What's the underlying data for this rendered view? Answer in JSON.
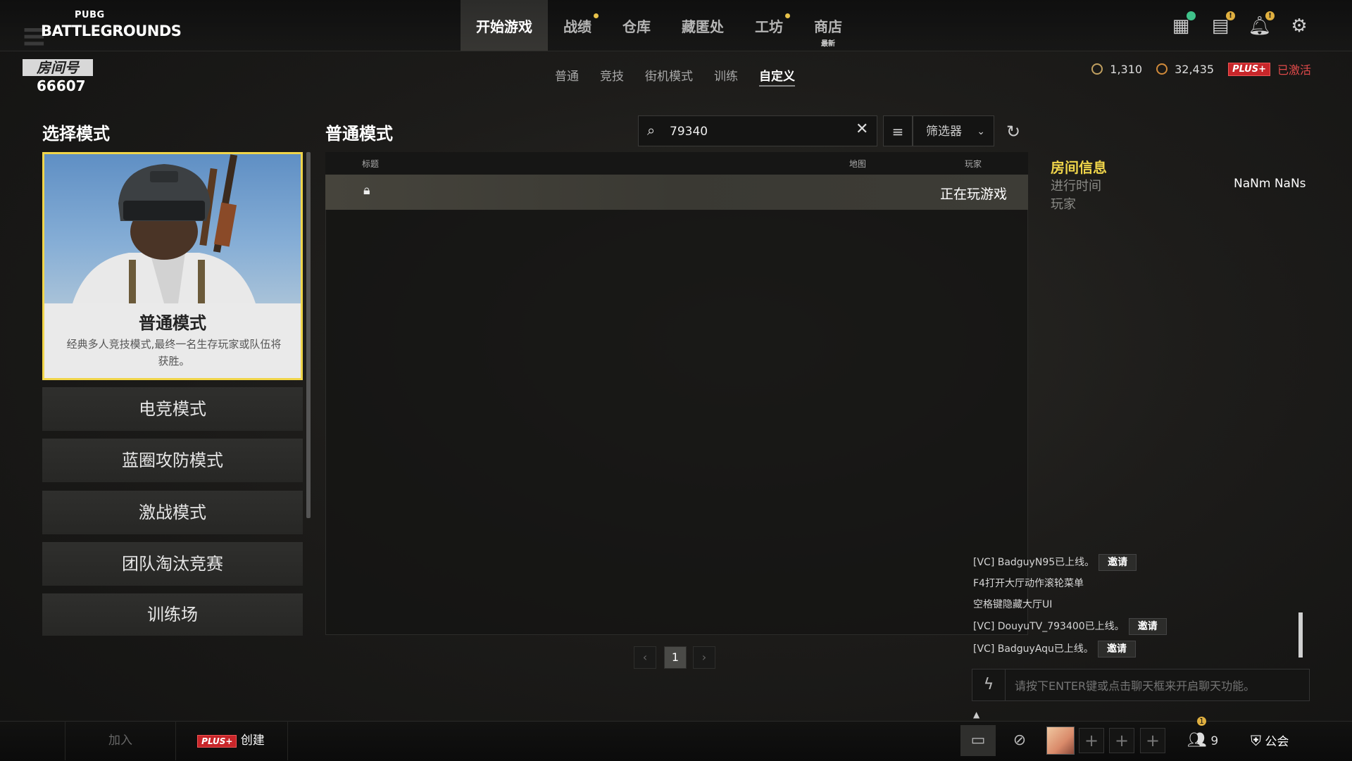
{
  "app": {
    "logo_small": "PUBG",
    "logo_main": "BATTLEGROUNDS",
    "room_label": "房间号",
    "room_number": "66607"
  },
  "nav": {
    "tabs": [
      {
        "label": "开始游戏"
      },
      {
        "label": "战绩"
      },
      {
        "label": "仓库"
      },
      {
        "label": "藏匿处"
      },
      {
        "label": "工坊"
      },
      {
        "label": "商店",
        "badge": "最新"
      }
    ],
    "sub_tabs": [
      "普通",
      "竞技",
      "街机模式",
      "训练",
      "自定义"
    ]
  },
  "currency": {
    "g_coin": "1,310",
    "bp": "32,435",
    "plus_badge": "PLUS+",
    "plus_status": "已激活"
  },
  "left": {
    "title": "选择模式",
    "selected_mode": {
      "name": "普通模式",
      "description": "经典多人竞技模式,最终一名生存玩家或队伍将获胜。"
    },
    "modes": [
      "电竞模式",
      "蓝圈攻防模式",
      "激战模式",
      "团队淘汰竞赛",
      "训练场"
    ]
  },
  "list": {
    "title": "普通模式",
    "search_value": "79340",
    "filter_label": "筛选器",
    "columns": {
      "title": "标题",
      "map": "地图",
      "players": "玩家"
    },
    "rows": [
      {
        "status": "正在玩游戏"
      }
    ],
    "page": "1"
  },
  "room_info": {
    "title": "房间信息",
    "elapsed_label": "进行时间",
    "elapsed_value": "NaNm NaNs",
    "players_label": "玩家"
  },
  "chat": {
    "lines": [
      {
        "text": "[VC] BadguyN95已上线。",
        "invite": "邀请"
      },
      {
        "text": "F4打开大厅动作滚轮菜单"
      },
      {
        "text": "空格键隐藏大厅UI"
      },
      {
        "text": "[VC] DouyuTV_793400已上线。",
        "invite": "邀请"
      },
      {
        "text": "[VC] BadguyAqu已上线。",
        "invite": "邀请"
      }
    ],
    "placeholder": "请按下ENTER键或点击聊天框来开启聊天功能。"
  },
  "bottom": {
    "join": "加入",
    "create_badge": "PLUS+",
    "create": "创建",
    "friends_count": "9",
    "friends_alert": "1",
    "clan": "公会"
  },
  "colors": {
    "accent_yellow": "#f0d54a",
    "plus_red": "#c8262a"
  }
}
